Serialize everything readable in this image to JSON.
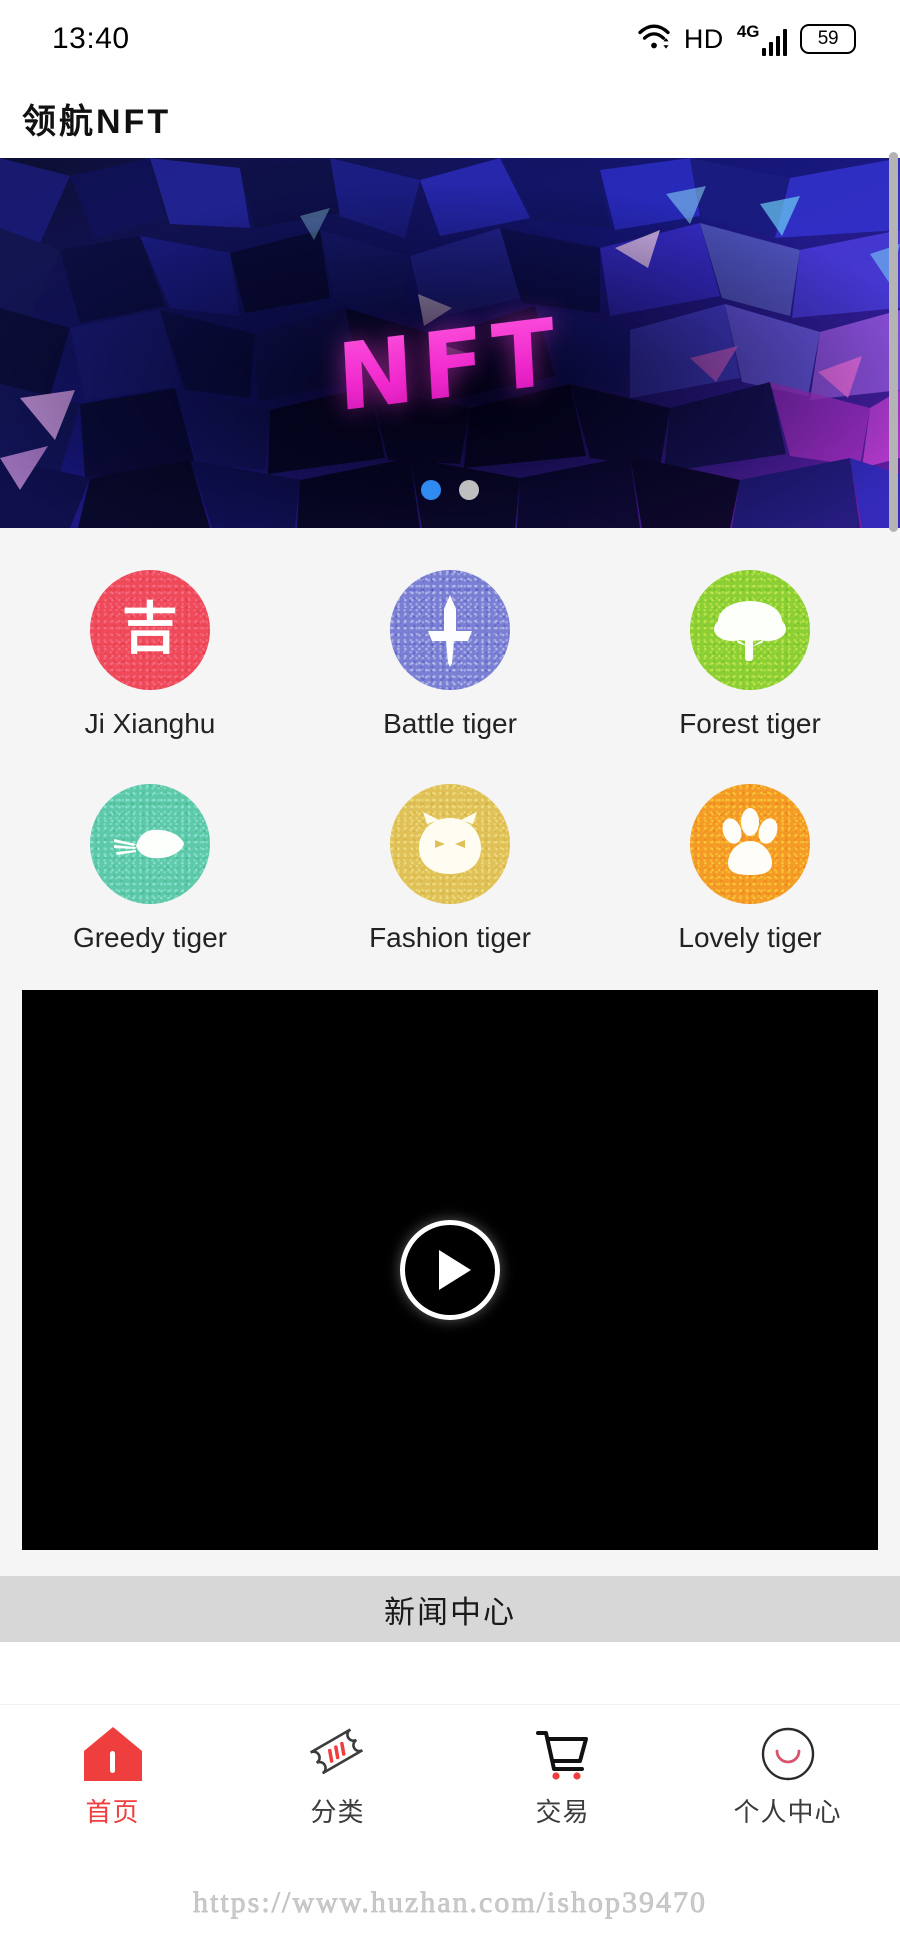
{
  "statusbar": {
    "time": "13:40",
    "hd_label": "HD",
    "network_label": "4G",
    "battery_level": "59",
    "wifi_icon": "wifi-icon",
    "signal_icon": "signal-bars-icon",
    "battery_icon": "battery-icon"
  },
  "header": {
    "title": "领航NFT"
  },
  "banner": {
    "overlay_text": "NFT",
    "slides_total": 2,
    "active_slide": 1,
    "active_dot_color": "#2f8bf0",
    "inactive_dot_color": "#bfbfbf",
    "background_colors": [
      "#0a0a28",
      "#1b1aa8",
      "#4a2fd6",
      "#e83ccf",
      "#6fd0f7"
    ]
  },
  "categories": {
    "items": [
      {
        "label": "Ji Xianghu",
        "icon": "luck-character-icon",
        "color": "#ee4a5a",
        "glyph": "吉"
      },
      {
        "label": "Battle tiger",
        "icon": "sword-icon",
        "color": "#7b7fd4",
        "glyph": ""
      },
      {
        "label": "Forest tiger",
        "icon": "tree-icon",
        "color": "#8ccf35",
        "glyph": ""
      },
      {
        "label": "Greedy tiger",
        "icon": "fork-icon",
        "color": "#5ec9a8",
        "glyph": ""
      },
      {
        "label": "Fashion tiger",
        "icon": "cat-face-icon",
        "color": "#e0c158",
        "glyph": ""
      },
      {
        "label": "Lovely tiger",
        "icon": "paw-print-icon",
        "color": "#f49a26",
        "glyph": ""
      }
    ]
  },
  "video": {
    "play_icon": "play-button-icon",
    "background_color": "#000000"
  },
  "news": {
    "section_title": "新闻中心"
  },
  "tabbar": {
    "items": [
      {
        "label": "首页",
        "icon": "home-icon",
        "active": true
      },
      {
        "label": "分类",
        "icon": "ticket-icon",
        "active": false
      },
      {
        "label": "交易",
        "icon": "cart-icon",
        "active": false
      },
      {
        "label": "个人中心",
        "icon": "smiley-face-icon",
        "active": false
      }
    ],
    "active_color": "#ef3e3e"
  },
  "watermark": {
    "text": "https://www.huzhan.com/ishop39470"
  }
}
